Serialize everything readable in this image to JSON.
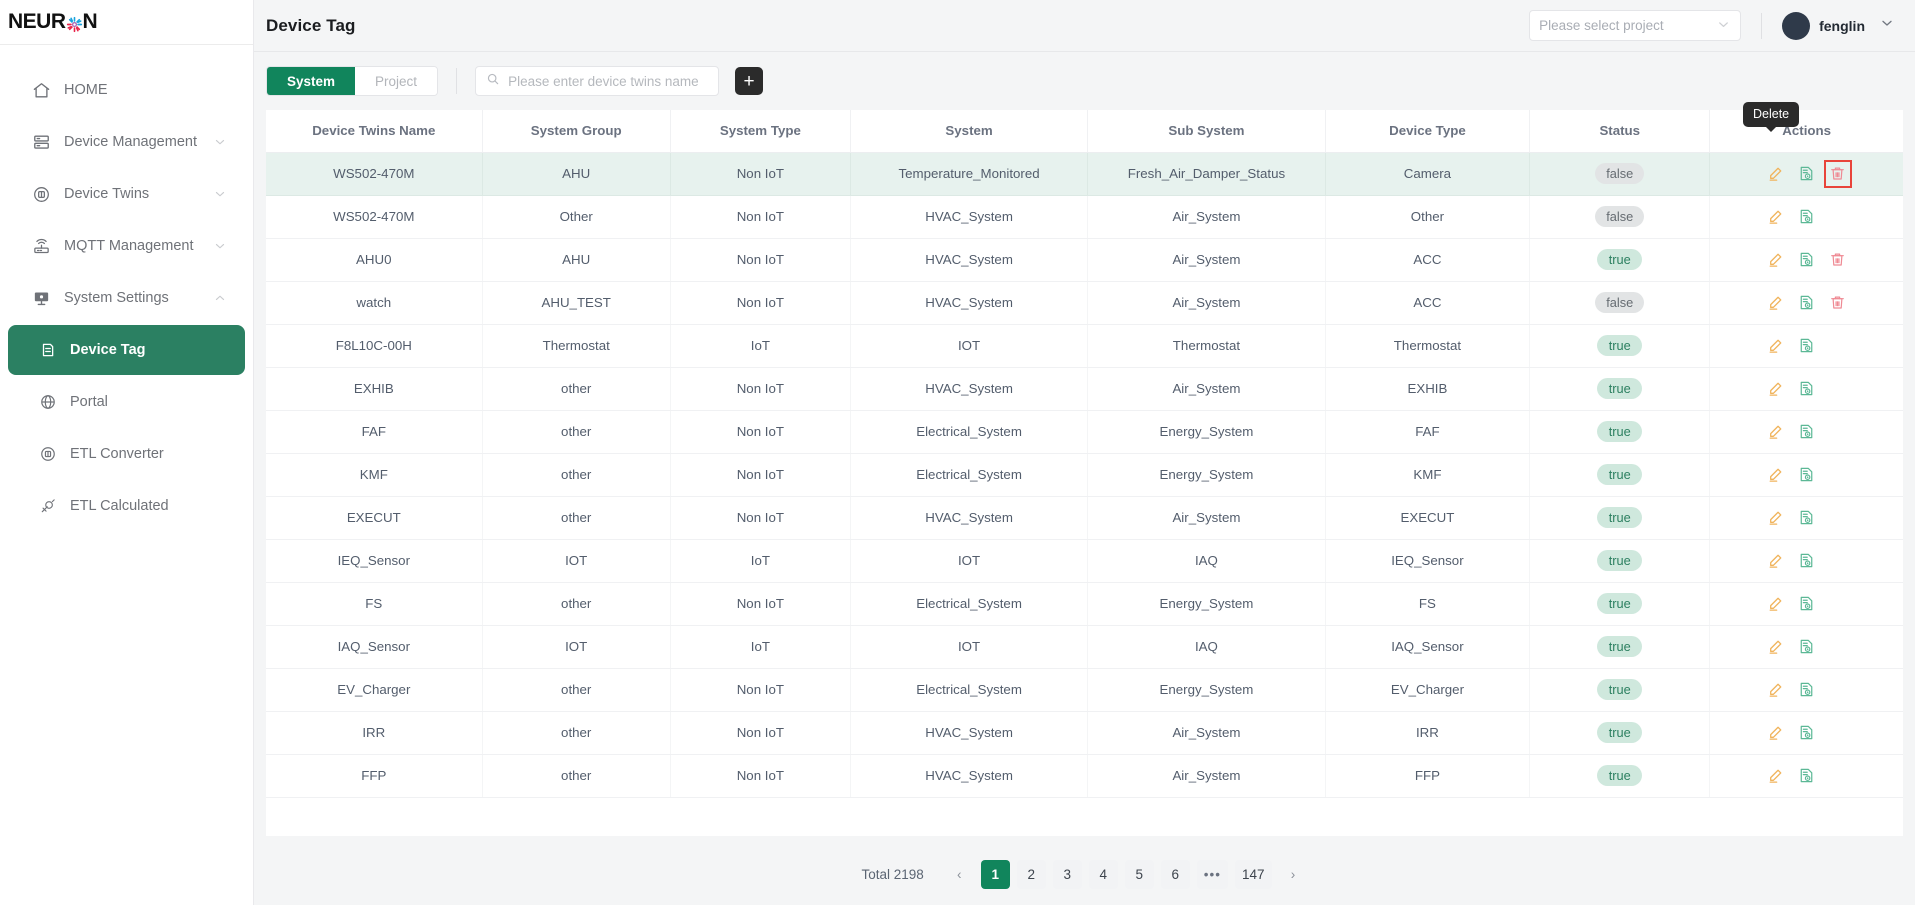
{
  "brand": {
    "name_prefix": "NEUR",
    "name_suffix": "N",
    "logo_icon": "burst-icon"
  },
  "sidebar": {
    "items": [
      {
        "label": "HOME",
        "icon": "home-icon",
        "expandable": false,
        "active": false,
        "child": false
      },
      {
        "label": "Device Management",
        "icon": "server-icon",
        "expandable": true,
        "active": false,
        "child": false
      },
      {
        "label": "Device Twins",
        "icon": "twins-icon",
        "expandable": true,
        "active": false,
        "child": false
      },
      {
        "label": "MQTT Management",
        "icon": "router-icon",
        "expandable": true,
        "active": false,
        "child": false
      },
      {
        "label": "System Settings",
        "icon": "monitor-icon",
        "expandable": true,
        "expanded": true,
        "active": false,
        "child": false
      },
      {
        "label": "Device Tag",
        "icon": "tag-icon",
        "expandable": false,
        "active": true,
        "child": true
      },
      {
        "label": "Portal",
        "icon": "globe-icon",
        "expandable": false,
        "active": false,
        "child": true
      },
      {
        "label": "ETL Converter",
        "icon": "converter-icon",
        "expandable": false,
        "active": false,
        "child": true
      },
      {
        "label": "ETL Calculated",
        "icon": "calculated-icon",
        "expandable": false,
        "active": false,
        "child": true
      }
    ]
  },
  "header": {
    "title": "Device Tag",
    "project_select_placeholder": "Please select project",
    "user_name": "fenglin"
  },
  "toolbar": {
    "tabs": [
      {
        "label": "System",
        "active": true
      },
      {
        "label": "Project",
        "active": false
      }
    ],
    "search_placeholder": "Please enter device twins name",
    "add_label": "+"
  },
  "tooltip": {
    "text": "Delete"
  },
  "table": {
    "columns": [
      "Device Twins Name",
      "System Group",
      "System Type",
      "System",
      "Sub System",
      "Device Type",
      "Status",
      "Actions"
    ],
    "rows": [
      {
        "name": "WS502-470M",
        "group": "AHU",
        "sys_type": "Non IoT",
        "system": "Temperature_Monitored",
        "sub_system": "Fresh_Air_Damper_Status",
        "device_type": "Camera",
        "status": "false",
        "highlight": true,
        "has_delete": true
      },
      {
        "name": "WS502-470M",
        "group": "Other",
        "sys_type": "Non IoT",
        "system": "HVAC_System",
        "sub_system": "Air_System",
        "device_type": "Other",
        "status": "false",
        "highlight": false,
        "has_delete": false
      },
      {
        "name": "AHU0",
        "group": "AHU",
        "sys_type": "Non IoT",
        "system": "HVAC_System",
        "sub_system": "Air_System",
        "device_type": "ACC",
        "status": "true",
        "highlight": false,
        "has_delete": true
      },
      {
        "name": "watch",
        "group": "AHU_TEST",
        "sys_type": "Non IoT",
        "system": "HVAC_System",
        "sub_system": "Air_System",
        "device_type": "ACC",
        "status": "false",
        "highlight": false,
        "has_delete": true
      },
      {
        "name": "F8L10C-00H",
        "group": "Thermostat",
        "sys_type": "IoT",
        "system": "IOT",
        "sub_system": "Thermostat",
        "device_type": "Thermostat",
        "status": "true",
        "highlight": false,
        "has_delete": false
      },
      {
        "name": "EXHIB",
        "group": "other",
        "sys_type": "Non IoT",
        "system": "HVAC_System",
        "sub_system": "Air_System",
        "device_type": "EXHIB",
        "status": "true",
        "highlight": false,
        "has_delete": false
      },
      {
        "name": "FAF",
        "group": "other",
        "sys_type": "Non IoT",
        "system": "Electrical_System",
        "sub_system": "Energy_System",
        "device_type": "FAF",
        "status": "true",
        "highlight": false,
        "has_delete": false
      },
      {
        "name": "KMF",
        "group": "other",
        "sys_type": "Non IoT",
        "system": "Electrical_System",
        "sub_system": "Energy_System",
        "device_type": "KMF",
        "status": "true",
        "highlight": false,
        "has_delete": false
      },
      {
        "name": "EXECUT",
        "group": "other",
        "sys_type": "Non IoT",
        "system": "HVAC_System",
        "sub_system": "Air_System",
        "device_type": "EXECUT",
        "status": "true",
        "highlight": false,
        "has_delete": false
      },
      {
        "name": "IEQ_Sensor",
        "group": "IOT",
        "sys_type": "IoT",
        "system": "IOT",
        "sub_system": "IAQ",
        "device_type": "IEQ_Sensor",
        "status": "true",
        "highlight": false,
        "has_delete": false
      },
      {
        "name": "FS",
        "group": "other",
        "sys_type": "Non IoT",
        "system": "Electrical_System",
        "sub_system": "Energy_System",
        "device_type": "FS",
        "status": "true",
        "highlight": false,
        "has_delete": false
      },
      {
        "name": "IAQ_Sensor",
        "group": "IOT",
        "sys_type": "IoT",
        "system": "IOT",
        "sub_system": "IAQ",
        "device_type": "IAQ_Sensor",
        "status": "true",
        "highlight": false,
        "has_delete": false
      },
      {
        "name": "EV_Charger",
        "group": "other",
        "sys_type": "Non IoT",
        "system": "Electrical_System",
        "sub_system": "Energy_System",
        "device_type": "EV_Charger",
        "status": "true",
        "highlight": false,
        "has_delete": false
      },
      {
        "name": "IRR",
        "group": "other",
        "sys_type": "Non IoT",
        "system": "HVAC_System",
        "sub_system": "Air_System",
        "device_type": "IRR",
        "status": "true",
        "highlight": false,
        "has_delete": false
      },
      {
        "name": "FFP",
        "group": "other",
        "sys_type": "Non IoT",
        "system": "HVAC_System",
        "sub_system": "Air_System",
        "device_type": "FFP",
        "status": "true",
        "highlight": false,
        "has_delete": false
      }
    ],
    "action_icons": [
      "edit-icon",
      "view-icon",
      "delete-icon"
    ]
  },
  "pagination": {
    "total_label": "Total 2198",
    "prev": "‹",
    "next": "›",
    "pages": [
      "1",
      "2",
      "3",
      "4",
      "5",
      "6",
      "•••",
      "147"
    ],
    "current": "1"
  },
  "colors": {
    "accent_green": "#11855c",
    "sidebar_active_green": "#2b8062",
    "badge_true_bg": "#cfe8dd",
    "badge_false_bg": "#e2e4e5",
    "edit_icon": "#f0b35b",
    "view_icon": "#5cb896",
    "delete_icon": "#ef8a94",
    "focus_outline": "#e8443a",
    "tooltip_bg": "#2b2b2b"
  }
}
